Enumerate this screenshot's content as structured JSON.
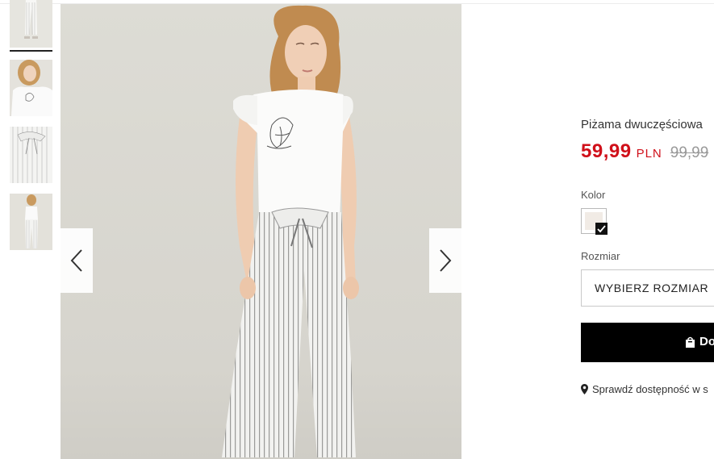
{
  "product": {
    "name": "Piżama dwuczęściowa",
    "price": "59,99",
    "currency": "PLN",
    "old_price": "99,99"
  },
  "color_section": {
    "label": "Kolor",
    "selected_swatch_color": "#f1ebe5"
  },
  "size_section": {
    "label": "Rozmiar",
    "select_value": "WYBIERZ ROZMIAR"
  },
  "add_to_cart": {
    "label": "Do"
  },
  "availability": {
    "text": "Sprawdź dostępność w s"
  },
  "gallery": {
    "thumbnail_count": 4,
    "active_index": 0,
    "prev_icon": "chevron-left-icon",
    "next_icon": "chevron-right-icon"
  },
  "colors": {
    "price_red": "#d0101a",
    "button_black": "#000000"
  }
}
